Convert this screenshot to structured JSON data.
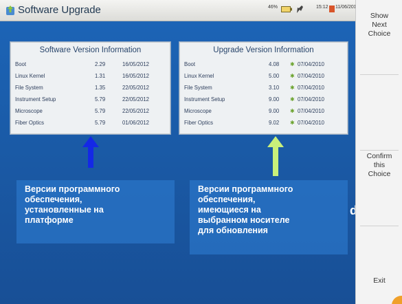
{
  "window": {
    "title": "Software Upgrade"
  },
  "status": {
    "battery": "46%",
    "time": "15:12",
    "date": "11/06/2012"
  },
  "software_panel": {
    "title": "Software Version Information",
    "rows": [
      {
        "name": "Boot",
        "version": "2.29",
        "date": "16/05/2012"
      },
      {
        "name": "Linux Kernel",
        "version": "1.31",
        "date": "16/05/2012"
      },
      {
        "name": "File System",
        "version": "1.35",
        "date": "22/05/2012"
      },
      {
        "name": "Instrument Setup",
        "version": "5.79",
        "date": "22/05/2012"
      },
      {
        "name": "Microscope",
        "version": "5.79",
        "date": "22/05/2012"
      },
      {
        "name": "Fiber Optics",
        "version": "5.79",
        "date": "01/06/2012"
      }
    ]
  },
  "upgrade_panel": {
    "title": "Upgrade Version Information",
    "rows": [
      {
        "name": "Boot",
        "version": "4.08",
        "date": "07/04/2010"
      },
      {
        "name": "Linux Kernel",
        "version": "5.00",
        "date": "07/04/2010"
      },
      {
        "name": "File System",
        "version": "3.10",
        "date": "07/04/2010"
      },
      {
        "name": "Instrument Setup",
        "version": "9.00",
        "date": "07/04/2010"
      },
      {
        "name": "Microscope",
        "version": "9.00",
        "date": "07/04/2010"
      },
      {
        "name": "Fiber Optics",
        "version": "9.02",
        "date": "07/04/2010"
      }
    ]
  },
  "callouts": {
    "left": [
      "Версии программного",
      "обеспечения,",
      "установленные на",
      "платформе"
    ],
    "right": [
      "Версии программного",
      "обеспечения,",
      "имеющиеся на",
      "выбранном носителе",
      "для обновления"
    ],
    "stray_glyph": "d"
  },
  "sidebar": {
    "show_next": [
      "Show",
      "Next",
      "Choice"
    ],
    "confirm": [
      "Confirm",
      "this",
      "Choice"
    ],
    "exit": "Exit"
  },
  "colors": {
    "arrow_left": "#1428e6",
    "arrow_right": "#c9f07a",
    "update_mark": "#6aa22c"
  }
}
